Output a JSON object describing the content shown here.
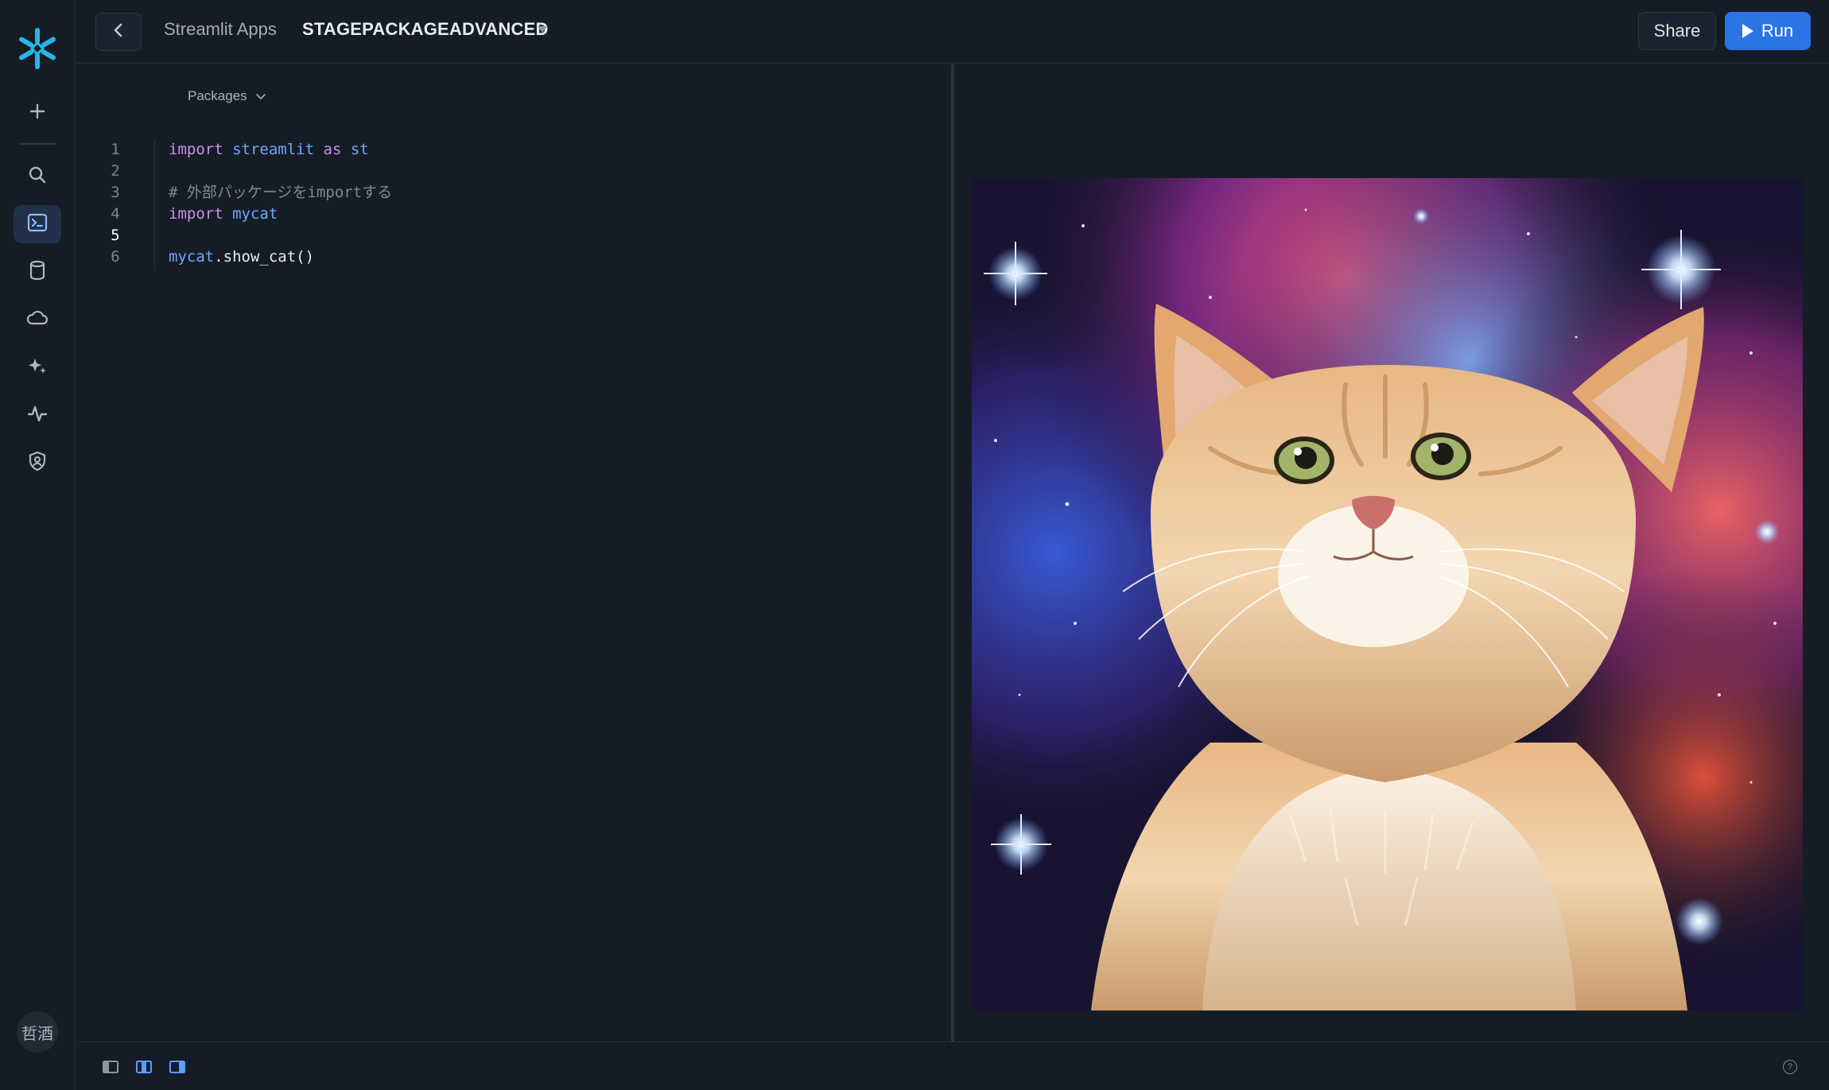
{
  "nav": {
    "user_initials": "哲酒",
    "items": [
      "snowflake-logo",
      "add",
      "search",
      "projects",
      "data",
      "data-products",
      "ai-ml",
      "monitoring",
      "admin"
    ]
  },
  "header": {
    "breadcrumb": "Streamlit Apps",
    "app_name": "STAGEPACKAGEADVANCED",
    "share_label": "Share",
    "run_label": "Run"
  },
  "editor": {
    "packages_label": "Packages",
    "current_line": 5,
    "lines": [
      {
        "num": "1",
        "tokens": [
          [
            "kw",
            "import"
          ],
          [
            "sp",
            " "
          ],
          [
            "mod",
            "streamlit"
          ],
          [
            "sp",
            " "
          ],
          [
            "kw",
            "as"
          ],
          [
            "sp",
            " "
          ],
          [
            "mod",
            "st"
          ]
        ]
      },
      {
        "num": "2",
        "tokens": []
      },
      {
        "num": "3",
        "tokens": [
          [
            "cmt",
            "# 外部パッケージをimportする"
          ]
        ]
      },
      {
        "num": "4",
        "tokens": [
          [
            "kw",
            "import"
          ],
          [
            "sp",
            " "
          ],
          [
            "mod",
            "mycat"
          ]
        ]
      },
      {
        "num": "5",
        "tokens": []
      },
      {
        "num": "6",
        "tokens": [
          [
            "mod",
            "mycat"
          ],
          [
            "fn",
            ".show_cat()"
          ]
        ]
      }
    ]
  },
  "colors": {
    "accent": "#2a74e6",
    "keyword": "#c792ea",
    "identifier": "#6fa8ff",
    "comment": "#7f8898"
  }
}
